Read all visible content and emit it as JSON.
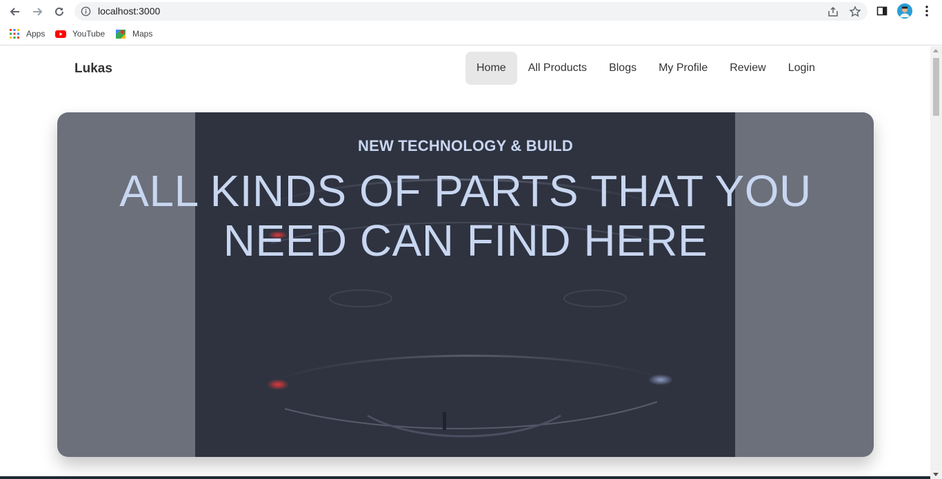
{
  "browser": {
    "url": "localhost:3000",
    "bookmarks": [
      {
        "label": "Apps",
        "icon": "apps-grid-icon"
      },
      {
        "label": "YouTube",
        "icon": "youtube-icon"
      },
      {
        "label": "Maps",
        "icon": "maps-icon"
      }
    ]
  },
  "site": {
    "brand": "Lukas",
    "nav": [
      "Home",
      "All Products",
      "Blogs",
      "My Profile",
      "Review",
      "Login"
    ],
    "active_nav": "Home"
  },
  "hero": {
    "subtitle": "NEW TECHNOLOGY & BUILD",
    "title_line1": "ALL KINDS OF PARTS THAT YOU",
    "title_line2": "NEED CAN FIND HERE"
  }
}
